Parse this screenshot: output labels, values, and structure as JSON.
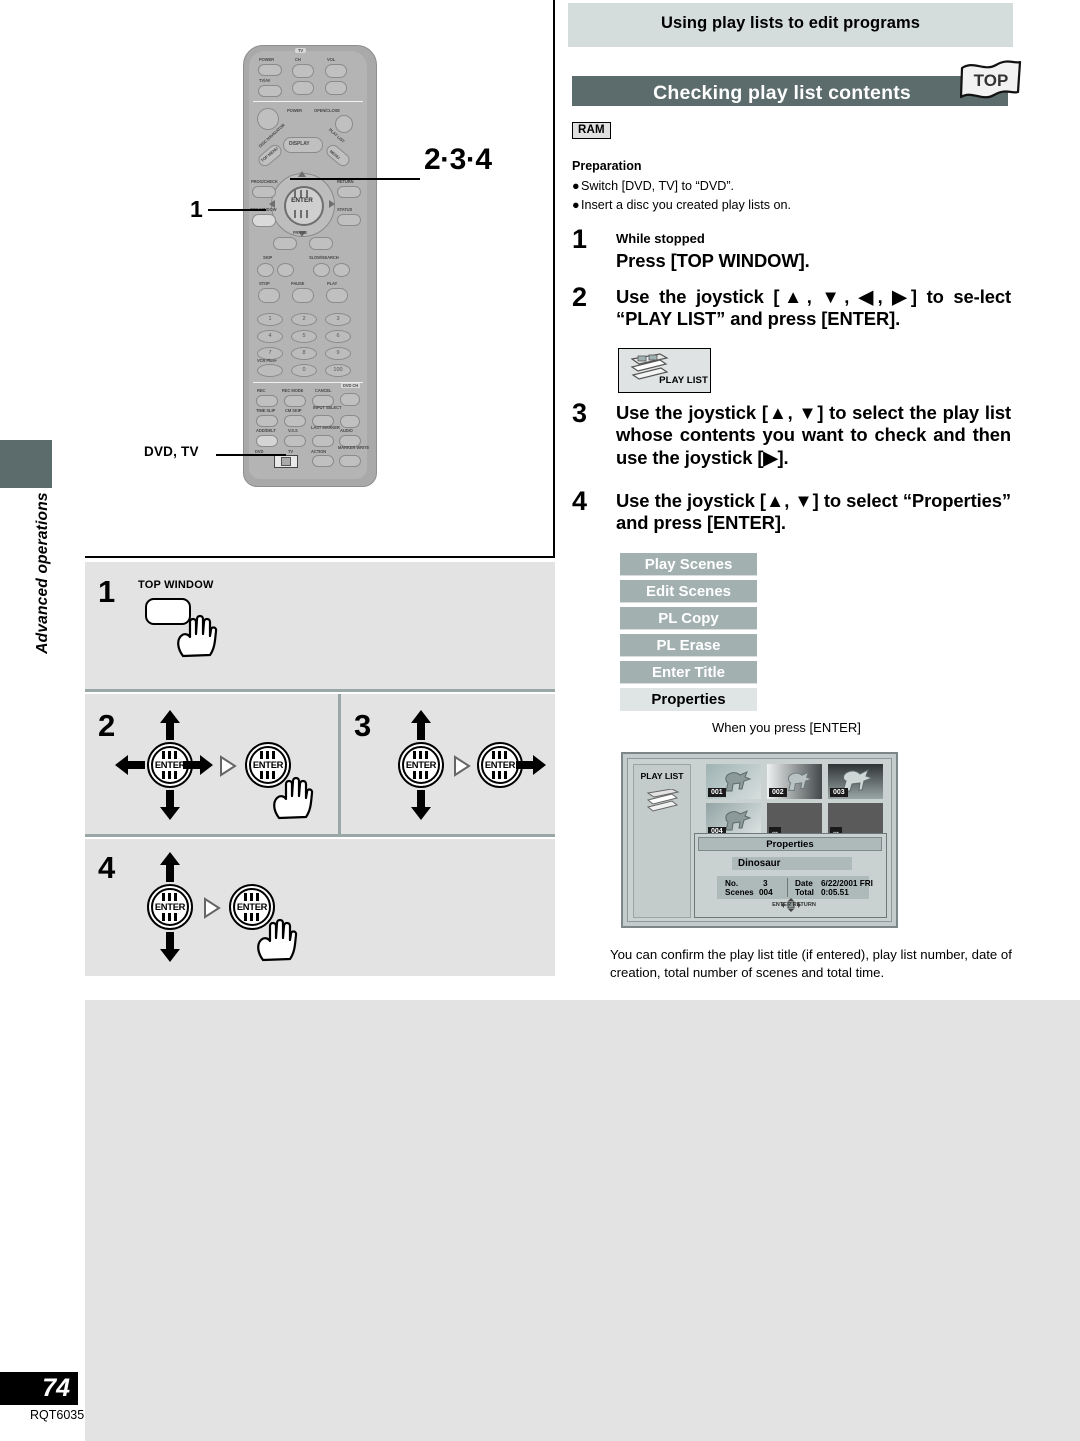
{
  "sidebar": {
    "section_label": "Advanced operations"
  },
  "footer": {
    "page_number": "74",
    "doc_code": "RQT6035"
  },
  "illustration": {
    "callout_steps": "2·3·4",
    "callout_step1": "1",
    "switch_label": "DVD, TV",
    "remote": {
      "tv_block": {
        "tv": "TV",
        "power": "POWER",
        "ch": "CH",
        "vol": "VOL",
        "tv_av": "TV/AV"
      },
      "main_block": {
        "power": "POWER",
        "open_close": "OPEN/CLOSE",
        "disc_navigator": "DISC NAVIGATOR",
        "top_menu": "TOP MENU",
        "display": "DISPLAY",
        "play_list": "PLAY LIST",
        "menu": "MENU",
        "prog_check": "PROG/CHECK",
        "return": "RETURN",
        "top_window": "TOP WINDOW",
        "status": "STATUS",
        "enter": "ENTER",
        "frame": "FRAME",
        "skip": "SKIP",
        "slow_search": "SLOW/SEARCH",
        "stop": "STOP",
        "pause": "PAUSE",
        "play": "PLAY"
      },
      "keypad": [
        "1",
        "2",
        "3",
        "4",
        "5",
        "6",
        "7",
        "8",
        "9",
        "0",
        "100"
      ],
      "vcr_plus": "VCR Plus+",
      "function_block": {
        "rec": "REC",
        "rec_mode": "REC MODE",
        "cancel": "CANCEL",
        "dvd_ch": "DVD CH",
        "time_slip": "TIME SLIP",
        "cm_skip": "CM SKIP",
        "input_select": "INPUT SELECT",
        "add_delete": "ADD/DELT",
        "vss": "V.S.S",
        "last_marker": "LAST MARKER",
        "audio": "AUDIO",
        "dvd": "DVD",
        "tv": "TV",
        "action": "ACTION",
        "marker_write": "MARKER WRITE"
      }
    }
  },
  "step_diagrams": {
    "step1": {
      "number": "1",
      "button_label": "TOP WINDOW"
    },
    "step2": {
      "number": "2",
      "dial_label": "ENTER"
    },
    "step3": {
      "number": "3",
      "dial_label": "ENTER"
    },
    "step4": {
      "number": "4",
      "dial_label": "ENTER"
    }
  },
  "content": {
    "section_header": "Using play lists to edit programs",
    "title": "Checking play list contents",
    "top_flag": "TOP",
    "media_badge": "RAM",
    "preparation": {
      "heading": "Preparation",
      "items": [
        "Switch [DVD, TV] to “DVD”.",
        "Insert a disc you created play lists on."
      ]
    },
    "steps": [
      {
        "number": "1",
        "sub": "While stopped",
        "text": "Press [TOP WINDOW]."
      },
      {
        "number": "2",
        "text": "Use the joystick [▲, ▼, ◀, ▶] to se-lect “PLAY LIST” and press [ENTER]."
      },
      {
        "number": "3",
        "text": "Use the joystick [▲, ▼] to select the play list whose contents you want to check and then use the joystick [▶]."
      },
      {
        "number": "4",
        "text": "Use the joystick [▲, ▼] to select “Properties” and press [ENTER]."
      }
    ],
    "playlist_icon_label": "PLAY LIST",
    "menu": {
      "items": [
        {
          "label": "Play Scenes",
          "selected": false
        },
        {
          "label": "Edit Scenes",
          "selected": false
        },
        {
          "label": "PL Copy",
          "selected": false
        },
        {
          "label": "PL Erase",
          "selected": false
        },
        {
          "label": "Enter Title",
          "selected": false
        },
        {
          "label": "Properties",
          "selected": true
        }
      ]
    },
    "when_press_enter": "When you press [ENTER]",
    "tv_screen": {
      "left_label": "PLAY LIST",
      "thumbnails": [
        "001",
        "002",
        "003",
        "004",
        "...",
        "..."
      ],
      "properties_dialog": {
        "header": "Properties",
        "title": "Dinosaur",
        "fields": [
          {
            "label": "No.",
            "value": "3"
          },
          {
            "label": "Date",
            "value": "6/22/2001  FRI"
          },
          {
            "label": "Scenes",
            "value": "004"
          },
          {
            "label": "Total",
            "value": "0:05.51"
          }
        ],
        "footer_hint": "ENTER        RETURN"
      }
    },
    "caption": "You can confirm the play list title (if entered), play list number, date of creation, total number of scenes and total time."
  },
  "colors": {
    "title_bar": "#5c6b6b",
    "section_header_band": "#d4dcdc",
    "menu_item": "#a3b0b0",
    "menu_item_selected": "#dfe4e4",
    "panel_gray": "#e3e3e3"
  }
}
